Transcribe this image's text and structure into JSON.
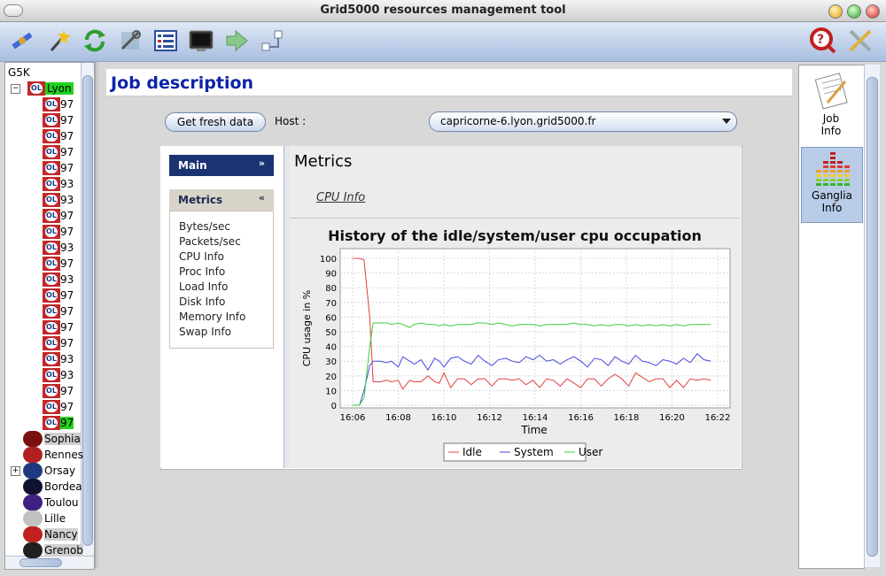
{
  "window": {
    "title": "Grid5000 resources management tool"
  },
  "toolbar": {
    "icons": [
      "satellite-icon",
      "magic-wand-icon",
      "refresh-icon",
      "tools-icon",
      "list-icon",
      "terminal-icon",
      "forward-arrow-icon",
      "connect-icon",
      "help-icon",
      "settings-icon"
    ]
  },
  "tree": {
    "root": "G5K",
    "sites": [
      {
        "name": "Lyon",
        "selected": true
      },
      {
        "name": "Sophia"
      },
      {
        "name": "Rennes"
      },
      {
        "name": "Orsay"
      },
      {
        "name": "Bordeaux"
      },
      {
        "name": "Toulouse"
      },
      {
        "name": "Lille"
      },
      {
        "name": "Nancy"
      },
      {
        "name": "Grenoble"
      }
    ],
    "site_labels_visible": [
      "Lyon",
      "Sophia",
      "Rennes",
      "Orsay",
      "Bordea",
      "Toulou",
      "Lille",
      "Nancy",
      "Grenob"
    ],
    "lyon_jobs": [
      "97",
      "97",
      "97",
      "97",
      "97",
      "93",
      "93",
      "97",
      "97",
      "93",
      "97",
      "93",
      "97",
      "97",
      "97",
      "97",
      "93",
      "93",
      "97",
      "97",
      "97"
    ]
  },
  "content": {
    "title": "Job description",
    "fresh_button": "Get fresh data",
    "host_label": "Host :",
    "host_value": "capricorne-6.lyon.grid5000.fr"
  },
  "nav": {
    "main_label": "Main",
    "metrics_label": "Metrics",
    "metrics_items": [
      "Bytes/sec",
      "Packets/sec",
      "CPU Info",
      "Proc Info",
      "Load Info",
      "Disk Info",
      "Memory Info",
      "Swap Info"
    ]
  },
  "metrics": {
    "title": "Metrics",
    "link": "CPU Info"
  },
  "right": {
    "job_info": "Job\nInfo",
    "job_info_lines": [
      "Job",
      "Info"
    ],
    "ganglia_lines": [
      "Ganglia",
      "Info"
    ]
  },
  "chart_data": {
    "type": "line",
    "title": "History of the idle/system/user cpu occupation",
    "xlabel": "Time",
    "ylabel": "CPU usage in %",
    "x_ticks": [
      "16:06",
      "16:08",
      "16:10",
      "16:12",
      "16:14",
      "16:16",
      "16:18",
      "16:20",
      "16:22"
    ],
    "y_ticks": [
      0,
      10,
      20,
      30,
      40,
      50,
      60,
      70,
      80,
      90,
      100
    ],
    "xlim": [
      0,
      16
    ],
    "ylim": [
      0,
      100
    ],
    "legend": "bottom-center",
    "colors": {
      "Idle": "#e04040",
      "System": "#4646e0",
      "User": "#3ccc3c"
    },
    "series": [
      {
        "name": "Idle",
        "x": [
          0,
          0.3,
          0.5,
          0.75,
          0.9,
          1.2,
          1.5,
          1.7,
          2.0,
          2.2,
          2.5,
          2.7,
          3.0,
          3.3,
          3.6,
          3.8,
          4.0,
          4.3,
          4.6,
          4.9,
          5.2,
          5.5,
          5.8,
          6.1,
          6.4,
          6.7,
          7.0,
          7.3,
          7.6,
          7.9,
          8.2,
          8.5,
          8.8,
          9.1,
          9.4,
          9.7,
          10.0,
          10.3,
          10.6,
          10.9,
          11.2,
          11.5,
          11.8,
          12.1,
          12.4,
          12.7,
          13.0,
          13.3,
          13.6,
          13.9,
          14.2,
          14.5,
          14.8,
          15.1,
          15.4,
          15.7
        ],
        "y": [
          100,
          100,
          99,
          60,
          16,
          16,
          17,
          16,
          17,
          11,
          17,
          16,
          16,
          20,
          16,
          15,
          22,
          12,
          18,
          18,
          14,
          18,
          18,
          13,
          18,
          18,
          17,
          18,
          14,
          17,
          12,
          18,
          17,
          13,
          18,
          15,
          12,
          18,
          18,
          13,
          18,
          21,
          18,
          13,
          22,
          19,
          16,
          18,
          18,
          12,
          17,
          12,
          18,
          17,
          18,
          17
        ]
      },
      {
        "name": "System",
        "x": [
          0,
          0.3,
          0.5,
          0.75,
          0.9,
          1.2,
          1.5,
          1.7,
          2.0,
          2.2,
          2.5,
          2.7,
          3.0,
          3.3,
          3.6,
          3.8,
          4.0,
          4.3,
          4.6,
          4.9,
          5.2,
          5.5,
          5.8,
          6.1,
          6.4,
          6.7,
          7.0,
          7.3,
          7.6,
          7.9,
          8.2,
          8.5,
          8.8,
          9.1,
          9.4,
          9.7,
          10.0,
          10.3,
          10.6,
          10.9,
          11.2,
          11.5,
          11.8,
          12.1,
          12.4,
          12.7,
          13.0,
          13.3,
          13.6,
          13.9,
          14.2,
          14.5,
          14.8,
          15.1,
          15.4,
          15.7
        ],
        "y": [
          0,
          0,
          10,
          27,
          30,
          30,
          29,
          30,
          26,
          33,
          30,
          28,
          31,
          24,
          32,
          30,
          26,
          32,
          33,
          30,
          28,
          34,
          30,
          27,
          31,
          32,
          30,
          29,
          33,
          31,
          34,
          30,
          31,
          28,
          31,
          33,
          30,
          26,
          32,
          31,
          27,
          33,
          30,
          28,
          34,
          30,
          29,
          27,
          31,
          30,
          28,
          32,
          29,
          35,
          31,
          30
        ]
      },
      {
        "name": "User",
        "x": [
          0,
          0.3,
          0.5,
          0.75,
          0.9,
          1.2,
          1.5,
          1.7,
          2.0,
          2.2,
          2.5,
          2.7,
          3.0,
          3.3,
          3.6,
          3.8,
          4.0,
          4.3,
          4.6,
          4.9,
          5.2,
          5.5,
          5.8,
          6.1,
          6.4,
          6.7,
          7.0,
          7.3,
          7.6,
          7.9,
          8.2,
          8.5,
          8.8,
          9.1,
          9.4,
          9.7,
          10.0,
          10.3,
          10.6,
          10.9,
          11.2,
          11.5,
          11.8,
          12.1,
          12.4,
          12.7,
          13.0,
          13.3,
          13.6,
          13.9,
          14.2,
          14.5,
          14.8,
          15.1,
          15.4,
          15.7
        ],
        "y": [
          0,
          0,
          5,
          40,
          56,
          56,
          56,
          55,
          56,
          55,
          53,
          55,
          56,
          55,
          55,
          54,
          55,
          54,
          55,
          55,
          55,
          56,
          56,
          55,
          56,
          55,
          54,
          55,
          55,
          55,
          54,
          55,
          55,
          55,
          55,
          56,
          55,
          55,
          54,
          55,
          54,
          55,
          55,
          54,
          55,
          54,
          55,
          54,
          55,
          54,
          55,
          54,
          55,
          55,
          55,
          55
        ]
      }
    ]
  }
}
